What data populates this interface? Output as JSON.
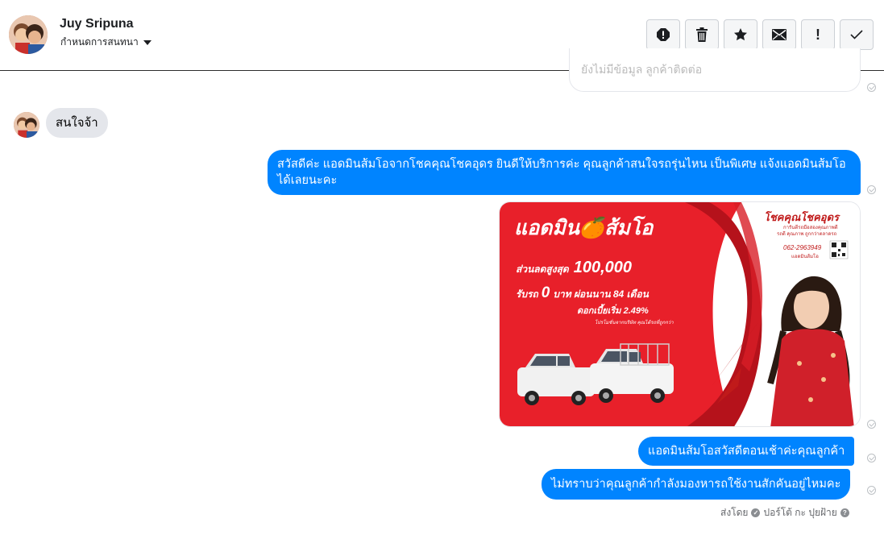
{
  "header": {
    "user_name": "Juy Sripuna",
    "convo_menu_label": "กำหนดการสนทนา",
    "actions": [
      {
        "name": "report-spam-button",
        "icon": "alert-circle-icon"
      },
      {
        "name": "delete-button",
        "icon": "trash-icon"
      },
      {
        "name": "star-button",
        "icon": "star-icon"
      },
      {
        "name": "mark-unread-button",
        "icon": "envelope-icon"
      },
      {
        "name": "follow-up-button",
        "icon": "exclamation-icon"
      },
      {
        "name": "mark-done-button",
        "icon": "check-icon"
      }
    ],
    "follow_up_glyph": "!"
  },
  "conversation": {
    "previous_partial": "ยังไม่มีข้อมูล ลูกค้าติดต่อ",
    "incoming_message": "สนใจจ้า",
    "outgoing": {
      "welcome": "สวัสดีค่ะ แอดมินส้มโอจากโชคคุณโชคอุดร ยินดีให้บริการค่ะ   คุณลูกค้าสนใจรถรุ่นไหน เป็นพิเศษ แจ้งแอดมินส้มโอ ได้เลยนะคะ",
      "greeting": "แอดมินส้มโอสวัสดีตอนเช้าค่ะคุณลูกค้า",
      "question": "ไม่ทราบว่าคุณลูกค้ากำลังมองหารถใช้งานสักคันอยู่ไหมคะ"
    },
    "promo_image": {
      "title": "แอดมิน🍊ส้มโอ",
      "discount_label": "ส่วนลดสูงสุด",
      "discount_value": "100,000",
      "down_label": "รับรถ",
      "down_value": "0",
      "down_suffix": "บาท ผ่อนนาน 84 เดือน",
      "interest": "ดอกเบี้ยเริ่ม 2.49%",
      "fine_print": "โปรโมชั่นจากบริษัท คุณได้รถที่ถูกกว่า",
      "shop_name": "โชคคุณโชคอุดร",
      "shop_tag1": "การันตีรถมือสองคุณภาพดี",
      "shop_tag2": "รถดี คุณภาพ ถูกกว่าตลาดรถ",
      "phone": "062-2963949",
      "admin_caption": "แอดมินส้มโอ"
    },
    "footer": {
      "sent_by_label": "ส่งโดย",
      "sender_name": "ปอร์โต้ กะ ปุยฝ้าย",
      "help_glyph": "?"
    }
  },
  "colors": {
    "outgoing_bubble": "#0084ff",
    "incoming_bubble": "#e4e6eb",
    "promo_red": "#e8202a"
  }
}
